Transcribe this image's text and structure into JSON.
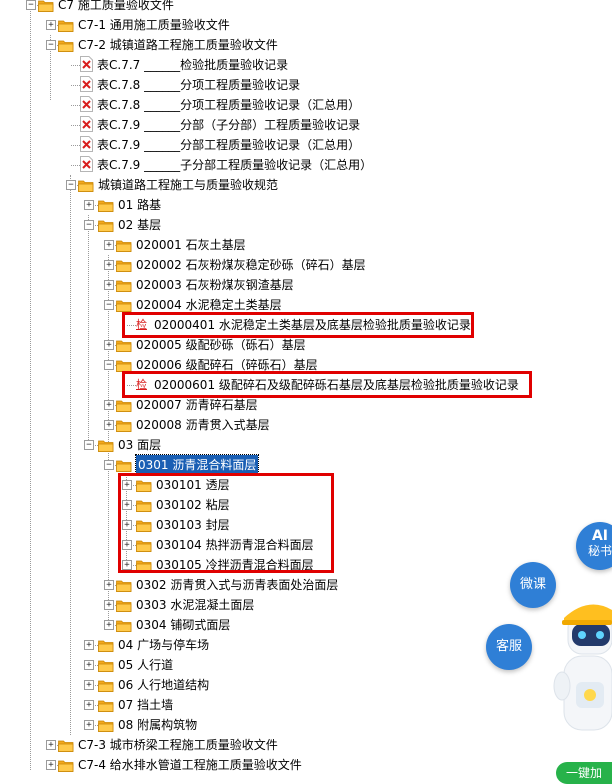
{
  "tree": {
    "nodes": [
      {
        "type": "folder",
        "level": 0,
        "text": "C7 施工质量验收文件",
        "expander": "-"
      },
      {
        "type": "folder",
        "level": 1,
        "text": "C7-1 通用施工质量验收文件",
        "expander": "+"
      },
      {
        "type": "folder",
        "level": 1,
        "text": "C7-2 城镇道路工程施工质量验收文件",
        "expander": "-"
      },
      {
        "type": "file",
        "level": 2,
        "text": "表C.7.7 ______检验批质量验收记录"
      },
      {
        "type": "file",
        "level": 2,
        "text": "表C.7.8 ______分项工程质量验收记录"
      },
      {
        "type": "file",
        "level": 2,
        "text": "表C.7.8 ______分项工程质量验收记录（汇总用）"
      },
      {
        "type": "file",
        "level": 2,
        "text": "表C.7.9 ______分部（子分部）工程质量验收记录"
      },
      {
        "type": "file",
        "level": 2,
        "text": "表C.7.9  ______分部工程质量验收记录（汇总用）"
      },
      {
        "type": "file",
        "level": 2,
        "text": "表C.7.9  ______子分部工程质量验收记录（汇总用）"
      },
      {
        "type": "folder",
        "level": 2,
        "text": "城镇道路工程施工与质量验收规范",
        "expander": "-"
      },
      {
        "type": "folder",
        "level": 3,
        "text": "01 路基",
        "expander": "+"
      },
      {
        "type": "folder",
        "level": 3,
        "text": "02 基层",
        "expander": "-"
      },
      {
        "type": "folder",
        "level": 4,
        "text": "020001 石灰土基层",
        "expander": "+"
      },
      {
        "type": "folder",
        "level": 4,
        "text": "020002 石灰粉煤灰稳定砂砾（碎石）基层",
        "expander": "+"
      },
      {
        "type": "folder",
        "level": 4,
        "text": "020003 石灰粉煤灰钢渣基层",
        "expander": "+"
      },
      {
        "type": "folder",
        "level": 4,
        "text": "020004 水泥稳定土类基层",
        "expander": "-"
      },
      {
        "type": "form",
        "level": 5,
        "text": "02000401 水泥稳定土类基层及底基层检验批质量验收记录"
      },
      {
        "type": "folder",
        "level": 4,
        "text": "020005 级配砂砾（砾石）基层",
        "expander": "+"
      },
      {
        "type": "folder",
        "level": 4,
        "text": "020006 级配碎石（碎砾石）基层",
        "expander": "-"
      },
      {
        "type": "form",
        "level": 5,
        "text": "02000601 级配碎石及级配碎砾石基层及底基层检验批质量验收记录"
      },
      {
        "type": "folder",
        "level": 4,
        "text": "020007 沥青碎石基层",
        "expander": "+"
      },
      {
        "type": "folder",
        "level": 4,
        "text": "020008 沥青贯入式基层",
        "expander": "+"
      },
      {
        "type": "folder",
        "level": 3,
        "text": "03 面层",
        "expander": "-"
      },
      {
        "type": "folder",
        "level": 4,
        "text": "0301 沥青混合料面层",
        "expander": "-",
        "selected": true
      },
      {
        "type": "folder",
        "level": 5,
        "text": "030101 透层",
        "expander": "+"
      },
      {
        "type": "folder",
        "level": 5,
        "text": "030102 粘层",
        "expander": "+"
      },
      {
        "type": "folder",
        "level": 5,
        "text": "030103 封层",
        "expander": "+"
      },
      {
        "type": "folder",
        "level": 5,
        "text": "030104 热拌沥青混合料面层",
        "expander": "+"
      },
      {
        "type": "folder",
        "level": 5,
        "text": "030105 冷拌沥青混合料面层",
        "expander": "+"
      },
      {
        "type": "folder",
        "level": 4,
        "text": "0302 沥青贯入式与沥青表面处治面层",
        "expander": "+"
      },
      {
        "type": "folder",
        "level": 4,
        "text": "0303 水泥混凝土面层",
        "expander": "+"
      },
      {
        "type": "folder",
        "level": 4,
        "text": "0304 铺砌式面层",
        "expander": "+"
      },
      {
        "type": "folder",
        "level": 3,
        "text": "04 广场与停车场",
        "expander": "+"
      },
      {
        "type": "folder",
        "level": 3,
        "text": "05 人行道",
        "expander": "+"
      },
      {
        "type": "folder",
        "level": 3,
        "text": "06 人行地道结构",
        "expander": "+"
      },
      {
        "type": "folder",
        "level": 3,
        "text": "07 挡土墙",
        "expander": "+"
      },
      {
        "type": "folder",
        "level": 3,
        "text": "08 附属构筑物",
        "expander": "+"
      },
      {
        "type": "folder",
        "level": 1,
        "text": "C7-3 城市桥梁工程施工质量验收文件",
        "expander": "+"
      },
      {
        "type": "folder",
        "level": 1,
        "text": "C7-4 给水排水管道工程施工质量验收文件",
        "expander": "+"
      }
    ],
    "form_badge": "检"
  },
  "floating": {
    "ai_label": "AI",
    "ai_sub": "秘书",
    "weike": "微课",
    "kefu": "客服",
    "yijian": "一键加"
  },
  "colors": {
    "folder": "#f2a81d",
    "highlight": "#e00000",
    "selection": "#1a5fb4",
    "float_button": "#2f7fd6",
    "green_button": "#27b24a"
  }
}
